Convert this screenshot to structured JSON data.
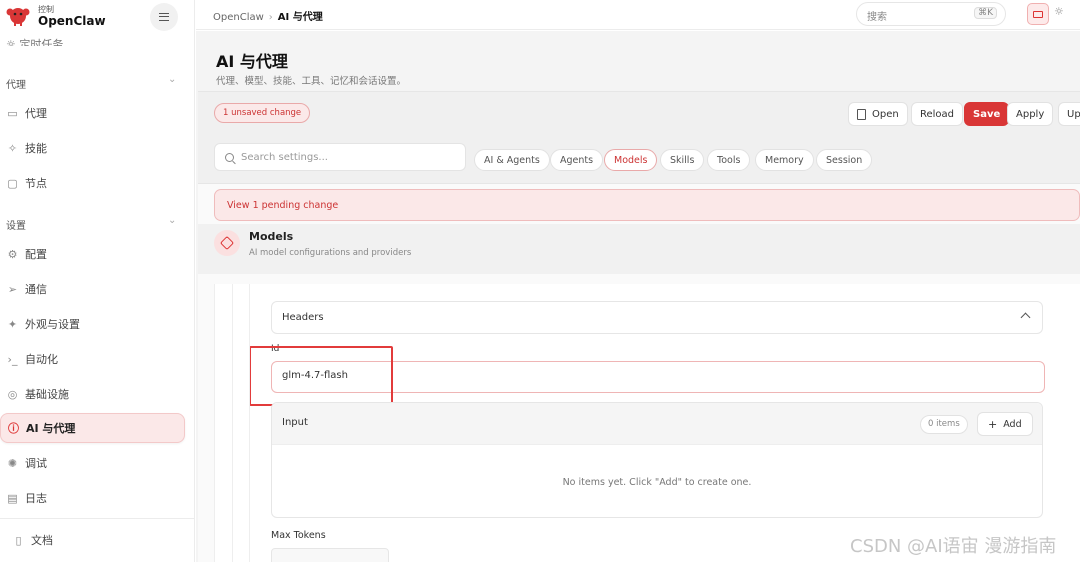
{
  "colors": {
    "accent": "#d93636",
    "accent_soft": "#fbe8e8",
    "border": "#e6e6e6"
  },
  "sidebar": {
    "brand_small": "控制",
    "brand": "OpenClaw",
    "cut_item": "定时任务",
    "section_agent": "代理",
    "items_agent": [
      {
        "label": "代理",
        "icon": "folder-icon"
      },
      {
        "label": "技能",
        "icon": "sparkle-icon"
      },
      {
        "label": "节点",
        "icon": "monitor-icon"
      }
    ],
    "section_settings": "设置",
    "items_settings": [
      {
        "label": "配置",
        "icon": "gear-icon"
      },
      {
        "label": "通信",
        "icon": "send-icon"
      },
      {
        "label": "外观与设置",
        "icon": "sun-icon"
      },
      {
        "label": "自动化",
        "icon": "terminal-icon"
      },
      {
        "label": "基础设施",
        "icon": "globe-icon"
      },
      {
        "label": "AI 与代理",
        "icon": "info-icon"
      },
      {
        "label": "调试",
        "icon": "bug-icon"
      },
      {
        "label": "日志",
        "icon": "file-icon"
      }
    ],
    "docs": "文档"
  },
  "topbar": {
    "crumb_root": "OpenClaw",
    "crumb_current": "AI 与代理",
    "search_placeholder": "搜索",
    "shortcut": "⌘K"
  },
  "main": {
    "title": "AI 与代理",
    "subtitle": "代理、模型、技能、工具、记忆和会话设置。",
    "unsaved": "1 unsaved change",
    "buttons": {
      "open": "Open",
      "reload": "Reload",
      "save": "Save",
      "apply": "Apply",
      "update": "Upd"
    },
    "search_placeholder": "Search settings...",
    "chips": [
      "AI & Agents",
      "Agents",
      "Models",
      "Skills",
      "Tools",
      "Memory",
      "Session"
    ],
    "active_chip": "Models",
    "pending": "View 1 pending change",
    "section_title": "Models",
    "section_sub": "AI model configurations and providers",
    "headers_label": "Headers",
    "id_label": "Id",
    "id_value": "glm-4.7-flash",
    "input_title": "Input",
    "items_count": "0 items",
    "add_label": "Add",
    "empty_text": "No items yet. Click \"Add\" to create one.",
    "max_tokens_label": "Max Tokens"
  },
  "watermark": "CSDN @AI语宙 漫游指南"
}
